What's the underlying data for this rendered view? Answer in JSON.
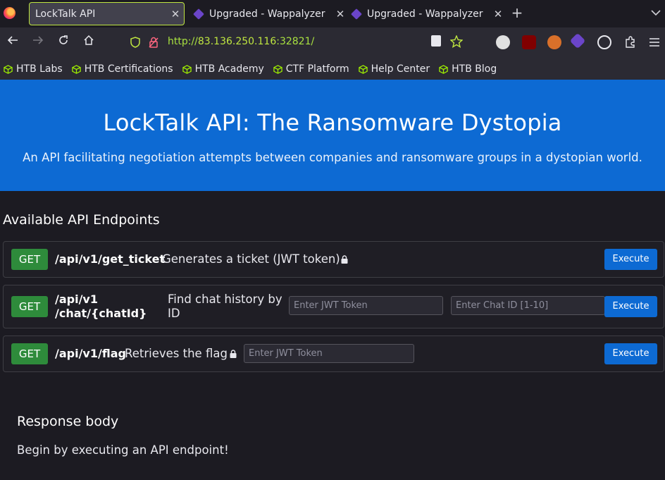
{
  "browser": {
    "tabs": [
      {
        "title": "LockTalk API",
        "active": true
      },
      {
        "title": "Upgraded - Wappalyzer",
        "active": false
      },
      {
        "title": "Upgraded - Wappalyzer",
        "active": false
      }
    ],
    "url": {
      "scheme": "http://",
      "host": "83.136.250.116",
      "port": ":32821/"
    },
    "bookmarks": [
      "HTB Labs",
      "HTB Certifications",
      "HTB Academy",
      "CTF Platform",
      "Help Center",
      "HTB Blog"
    ]
  },
  "hero": {
    "title": "LockTalk API: The Ransomware Dystopia",
    "subtitle": "An API facilitating negotiation attempts between companies and ransomware groups in a dystopian world."
  },
  "endpoints_title": "Available API Endpoints",
  "endpoints": [
    {
      "method": "GET",
      "path": "/api/v1/get_ticket",
      "description": "Generates a ticket (JWT token)",
      "button": "Execute"
    },
    {
      "method": "GET",
      "path_line1": "/api/v1",
      "path_line2": "/chat/{chatId}",
      "description_line1": "Find chat history by",
      "description_line2": "ID",
      "token_placeholder": "Enter JWT Token",
      "chat_placeholder": "Enter Chat ID [1-10]",
      "button": "Execute"
    },
    {
      "method": "GET",
      "path": "/api/v1/flag",
      "description": "Retrieves the flag",
      "token_placeholder": "Enter JWT Token",
      "button": "Execute"
    }
  ],
  "response": {
    "title": "Response body",
    "body": "Begin by executing an API endpoint!"
  },
  "colors": {
    "accent": "#0d6ad3",
    "method_get": "#2e8b3b",
    "url_green": "#bfe640"
  }
}
